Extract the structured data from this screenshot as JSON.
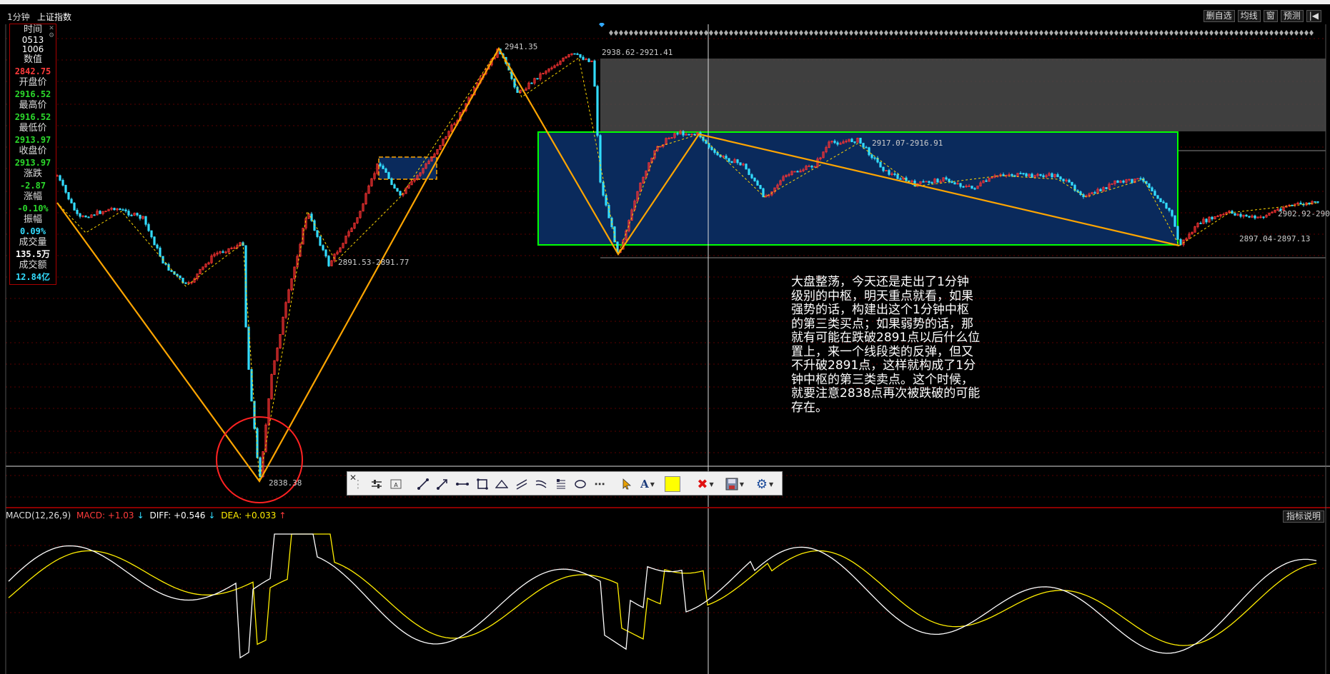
{
  "header": {
    "period": "1分钟",
    "index_name": "上证指数",
    "buttons": [
      "删自选",
      "均线",
      "窗",
      "预测"
    ]
  },
  "info_panel": {
    "time_label": "时间",
    "date": "0513",
    "clock": "1006",
    "value_label": "数值",
    "value": "2842.75",
    "open_label": "开盘价",
    "open": "2916.52",
    "high_label": "最高价",
    "high": "2916.52",
    "low_label": "最低价",
    "low": "2913.97",
    "close_label": "收盘价",
    "close": "2913.97",
    "change_label": "涨跌",
    "change": "-2.87",
    "pct_label": "涨幅",
    "pct": "-0.10%",
    "amp_label": "振幅",
    "amp": "0.09%",
    "vol_label": "成交量",
    "vol": "135.5万",
    "amt_label": "成交额",
    "amt": "12.84亿"
  },
  "price_labels": {
    "peak": "2941.35",
    "top_right": "2938.62-2921.41",
    "mid_high": "2917.07-2916.91",
    "left_mid": "2891.53-2891.77",
    "low": "2838.38",
    "right_low": "2897.04-2897.13",
    "right_end": "2902.92-290"
  },
  "annotation": "大盘整荡，今天还是走出了1分钟级别的中枢，明天重点就看，如果强势的话，构建出这个1分钟中枢的第三类买点；如果弱势的话，那就有可能在跌破2891点以后什么位置上，来一个线段类的反弹，但又不升破2891点，这样就构成了1分钟中枢的第三类卖点。这个时候，就要注意2838点再次被跌破的可能存在。",
  "annotation_lines": [
    "大盘整荡，今天还是走出了1分钟",
    "级别的中枢，明天重点就看，如果",
    "强势的话，构建出这个1分钟中枢",
    "的第三类买点；如果弱势的话，那",
    "就有可能在跌破2891点以后什么位",
    "置上，来一个线段类的反弹，但又",
    "不升破2891点，这样就构成了1分",
    "钟中枢的第三类卖点。这个时候，",
    "就要注意2838点再次被跌破的可能",
    "存在。"
  ],
  "macd": {
    "name": "MACD(12,26,9)",
    "macd_label": "MACD: +1.03",
    "diff_label": "DIFF: +0.546",
    "dea_label": "DEA: +0.033",
    "button": "指标说明"
  },
  "toolbar": {
    "tools": [
      "close-icon",
      "grip-icon",
      "settings-sliders-icon",
      "text-box-icon",
      "line-icon",
      "ray-icon",
      "segment-icon",
      "rectangle-icon",
      "triangle-icon",
      "parallel-lines-icon",
      "wave-lines-icon",
      "fib-icon",
      "ellipse-icon",
      "more-icon",
      "cursor-icon",
      "text-icon",
      "color-swatch-icon",
      "delete-icon",
      "save-icon",
      "gear-icon"
    ]
  },
  "colors": {
    "up": "#ff3333",
    "down": "#33ddff",
    "zigzag": "#ffa500",
    "zone_box": "#00ff00",
    "zone_fill": "#0a2a5c",
    "circle": "#ff2222",
    "macd_up": "#cc2020",
    "macd_down": "#20aa20",
    "diff": "#ffffff",
    "dea": "#ffee00"
  }
}
